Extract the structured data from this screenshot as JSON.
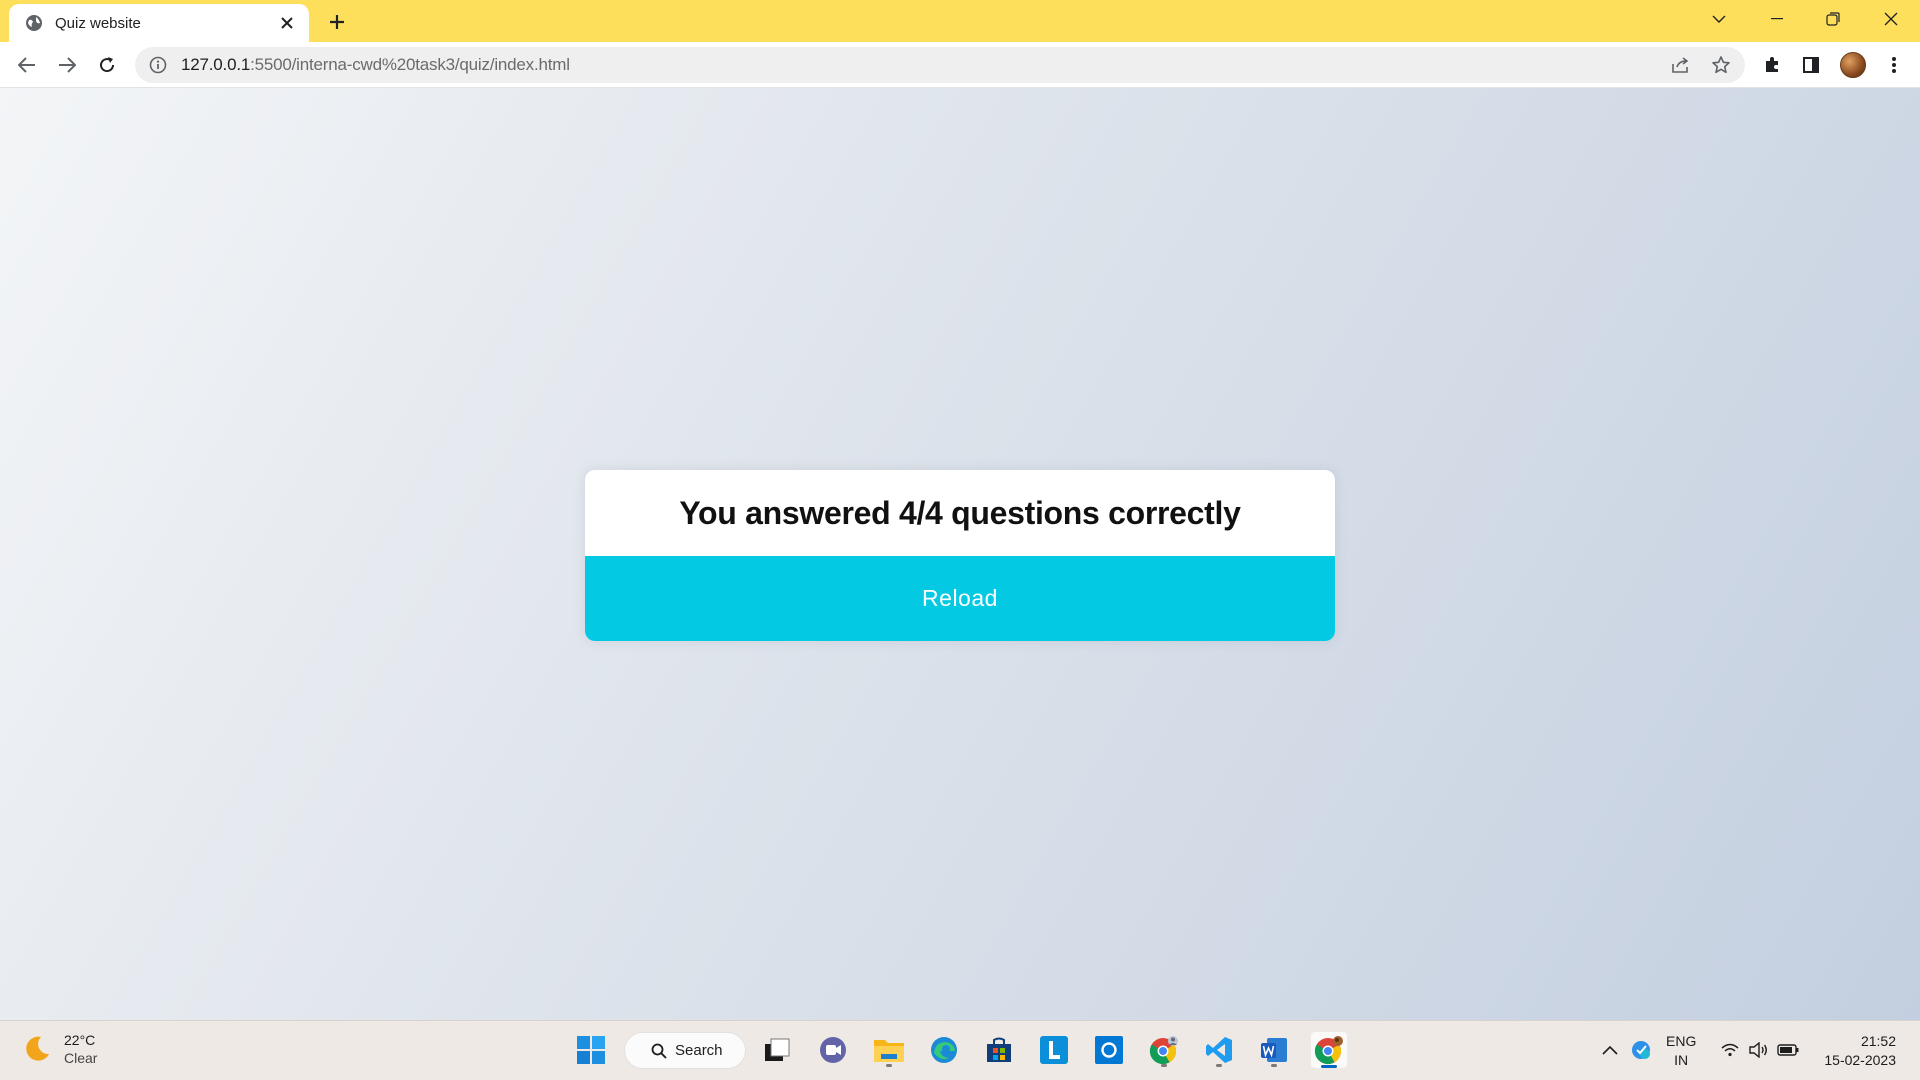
{
  "browser": {
    "tab_title": "Quiz website",
    "url_host": "127.0.0.1",
    "url_path": ":5500/interna-cwd%20task3/quiz/index.html"
  },
  "quiz": {
    "result_text": "You answered 4/4 questions correctly",
    "reload_label": "Reload"
  },
  "taskbar": {
    "weather_temp": "22°C",
    "weather_condition": "Clear",
    "search_label": "Search",
    "lang_primary": "ENG",
    "lang_region": "IN",
    "time": "21:52",
    "date": "15-02-2023",
    "pinned_apps": [
      "start",
      "search",
      "task-view",
      "meet",
      "file-explorer",
      "edge",
      "store",
      "linkedin-learning",
      "cortana",
      "chrome-profile",
      "vscode",
      "word",
      "chrome"
    ]
  },
  "colors": {
    "tab_strip": "#fedf5c",
    "accent_button": "#03c9e3",
    "card": "#ffffff"
  }
}
